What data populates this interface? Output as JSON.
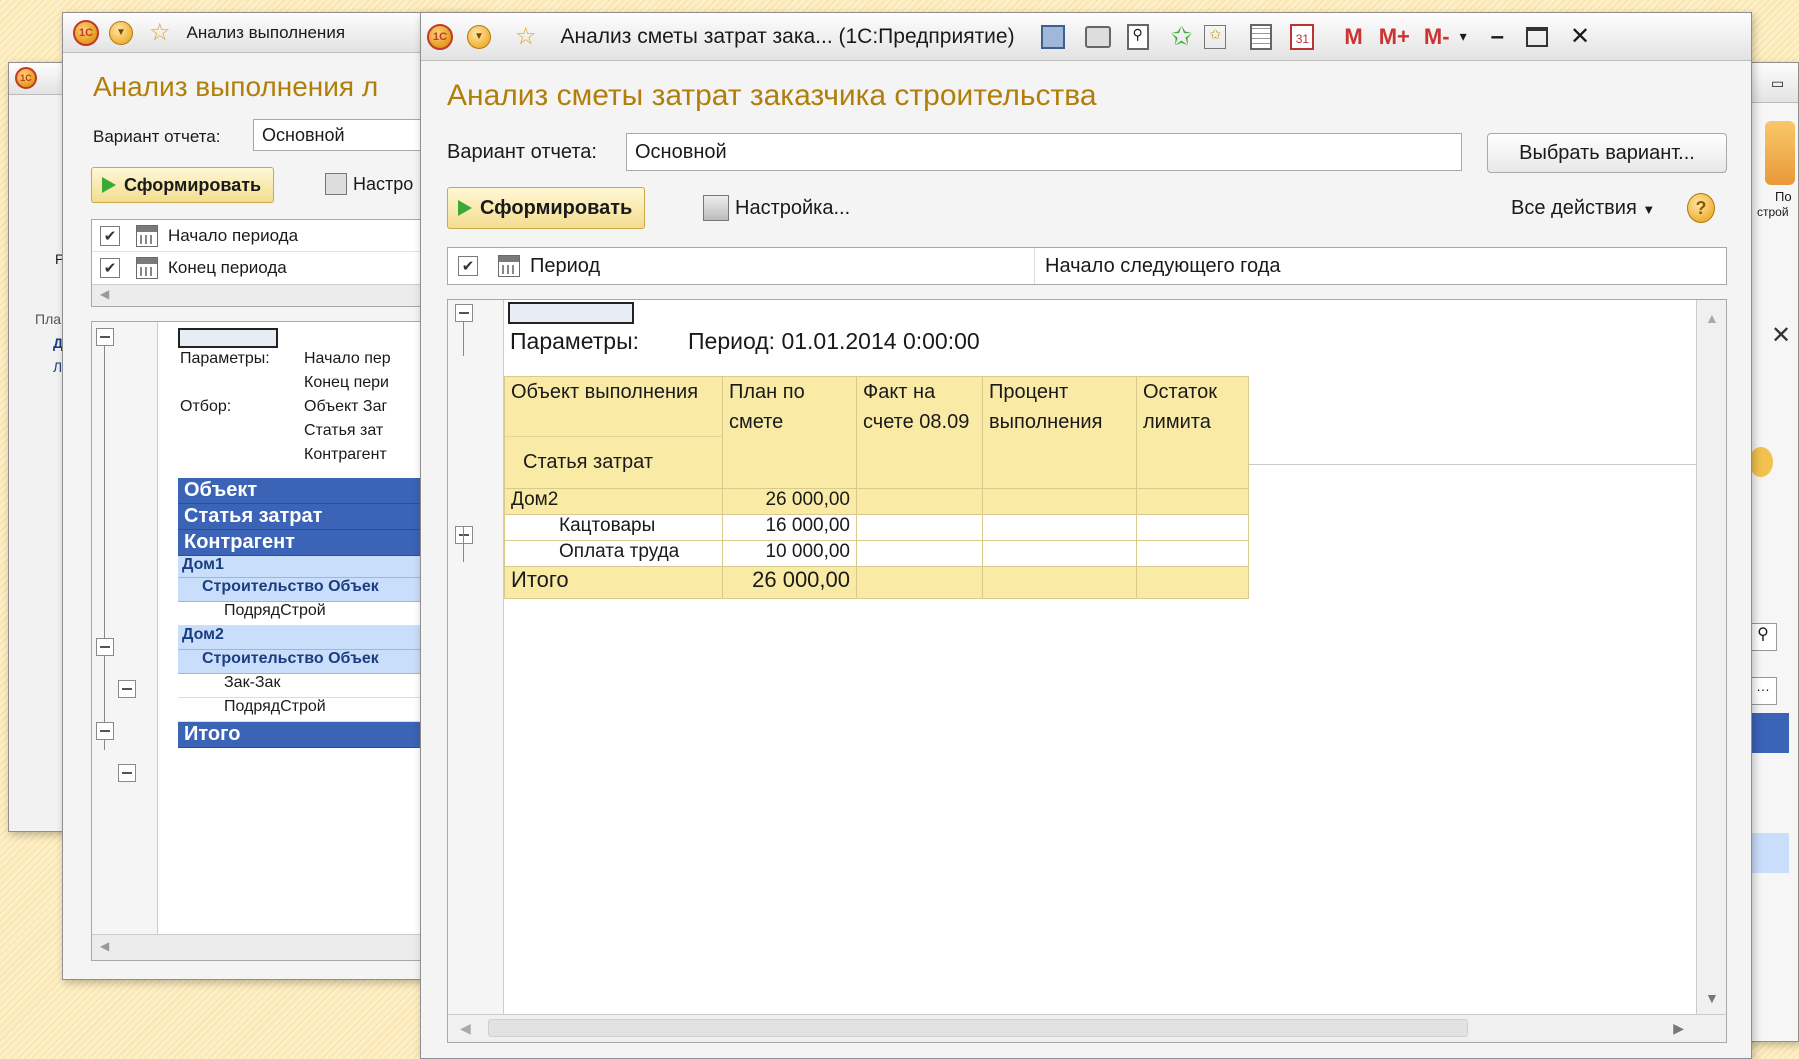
{
  "colors": {
    "accent": "#b17f09",
    "header_blue": "#3b63b6",
    "light_blue": "#c9defa",
    "report_yellow": "#f9eaa6",
    "form_button": "#f3dd8e"
  },
  "bg_window": {
    "tab_title": "Анализ выполнения",
    "heading": "Анализ выполнения л",
    "variant_label": "Вариант отчета:",
    "variant_value": "Основной",
    "form_button": "Сформировать",
    "settings_button": "Настро",
    "params": [
      {
        "checked": true,
        "label": "Начало периода"
      },
      {
        "checked": true,
        "label": "Конец периода"
      }
    ],
    "report": {
      "params_label": "Параметры:",
      "params_lines": [
        "Начало пер",
        "Конец пери"
      ],
      "filter_label": "Отбор:",
      "filter_lines": [
        "Объект Заг",
        "Статья зат",
        "Контрагент"
      ],
      "group_headers": [
        "Объект",
        "Статья затрат",
        "Контрагент"
      ],
      "rows": [
        {
          "text": "Дом1",
          "level": 0
        },
        {
          "text": "Строительство Объек",
          "level": 1
        },
        {
          "text": "ПодрядСтрой",
          "level": 2
        },
        {
          "text": "Дом2",
          "level": 0
        },
        {
          "text": "Строительство Объек",
          "level": 1
        },
        {
          "text": "Зак-Зак",
          "level": 2
        },
        {
          "text": "ПодрядСтрой",
          "level": 2
        }
      ],
      "total": "Итого"
    }
  },
  "left_edge": {
    "label1": "Р",
    "label2": "Пла",
    "label3": "Де",
    "label4": "Ли"
  },
  "right_edge": {
    "label1": "По",
    "label2": "строй"
  },
  "main_window": {
    "title": "Анализ сметы затрат зака... (1С:Предприятие)",
    "toolbar_icons": [
      "save-icon",
      "print-icon",
      "preview-icon",
      "add-favorite-icon",
      "favorites-icon",
      "calculator-icon",
      "calendar-icon"
    ],
    "memory_buttons": [
      "M",
      "M+",
      "M-"
    ],
    "heading": "Анализ сметы затрат заказчика строительства",
    "variant_label": "Вариант отчета:",
    "variant_value": "Основной",
    "choose_variant": "Выбрать вариант...",
    "form_button": "Сформировать",
    "settings_button": "Настройка...",
    "all_actions": "Все действия",
    "help": "?",
    "param_row": {
      "checked": true,
      "label": "Период",
      "value": "Начало следующего года"
    },
    "report": {
      "params_label": "Параметры:",
      "params_value": "Период: 01.01.2014 0:00:00",
      "columns": {
        "c1": "Объект выполнения",
        "c1_sub": "Статья затрат",
        "c2": "План по смете",
        "c3": "Факт на счете 08.09",
        "c4": "Процент выполнения",
        "c5": "Остаток лимита"
      },
      "rows": [
        {
          "name": "Дом2",
          "plan": "26 000,00",
          "group": true
        },
        {
          "name": "Кацтовары",
          "plan": "16 000,00",
          "group": false
        },
        {
          "name": "Оплата труда",
          "plan": "10 000,00",
          "group": false
        }
      ],
      "total": {
        "name": "Итого",
        "plan": "26 000,00"
      }
    }
  }
}
